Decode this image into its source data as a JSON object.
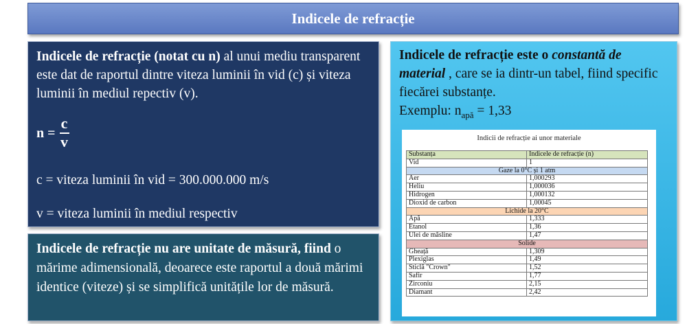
{
  "title": "Indicele de refracție",
  "definition": {
    "bold_term": "Indicele de refracție (notat cu n)",
    "rest": " al unui mediu transparent este dat de raportul dintre viteza luminii în vid (c) și viteza luminii în mediul repectiv (v).",
    "formula_lhs": "n =",
    "formula_num": "c",
    "formula_den": "v",
    "line_c": "c = viteza luminii în vid = 300.000.000 m/s",
    "line_v": "v = viteza luminii în mediul respectiv"
  },
  "unit_note": {
    "bold_1": "Indicele de refracție nu are unitate de măsură,",
    "bold_2": "fiind",
    "rest": " o mărime adimensională, deoarece este raportul a două mărimi identice (viteze) și se simplifică unitățile lor de măsură."
  },
  "constant_note": {
    "bold": "Indicele de refracție este o ",
    "bold_italic": "constantă de material",
    "rest": " , care se ia dintr-un tabel, fiind specific fiecărei substanțe.",
    "example_label": "Exemplu: n",
    "example_sub": "apă",
    "example_value": " = 1,33"
  },
  "table": {
    "caption": "Indicii de refracție ai unor materiale",
    "headers": [
      "Substanța",
      "Indicele de refracție (n)"
    ],
    "rows": [
      {
        "type": "row",
        "name": "Vid",
        "value": "1"
      },
      {
        "type": "section",
        "label": "Gaze la 0°C și 1 atm",
        "kind": "gas"
      },
      {
        "type": "row",
        "name": "Aer",
        "value": "1,000293"
      },
      {
        "type": "row",
        "name": "Heliu",
        "value": "1,000036"
      },
      {
        "type": "row",
        "name": "Hidrogen",
        "value": "1,000132"
      },
      {
        "type": "row",
        "name": "Dioxid de carbon",
        "value": "1,00045"
      },
      {
        "type": "section",
        "label": "Lichide la 20°C",
        "kind": "liq"
      },
      {
        "type": "row",
        "name": "Apă",
        "value": "1,333"
      },
      {
        "type": "row",
        "name": "Etanol",
        "value": "1,36"
      },
      {
        "type": "row",
        "name": "Ulei de măsline",
        "value": "1,47"
      },
      {
        "type": "section",
        "label": "Solide",
        "kind": "sol"
      },
      {
        "type": "row",
        "name": "Gheață",
        "value": "1,309"
      },
      {
        "type": "row",
        "name": "Plexiglas",
        "value": "1,49"
      },
      {
        "type": "row",
        "name": "Sticlă \"Crown\"",
        "value": "1,52"
      },
      {
        "type": "row",
        "name": "Safir",
        "value": "1,77"
      },
      {
        "type": "row",
        "name": "Zirconiu",
        "value": "2,15"
      },
      {
        "type": "row",
        "name": "Diamant",
        "value": "2,42"
      }
    ]
  }
}
